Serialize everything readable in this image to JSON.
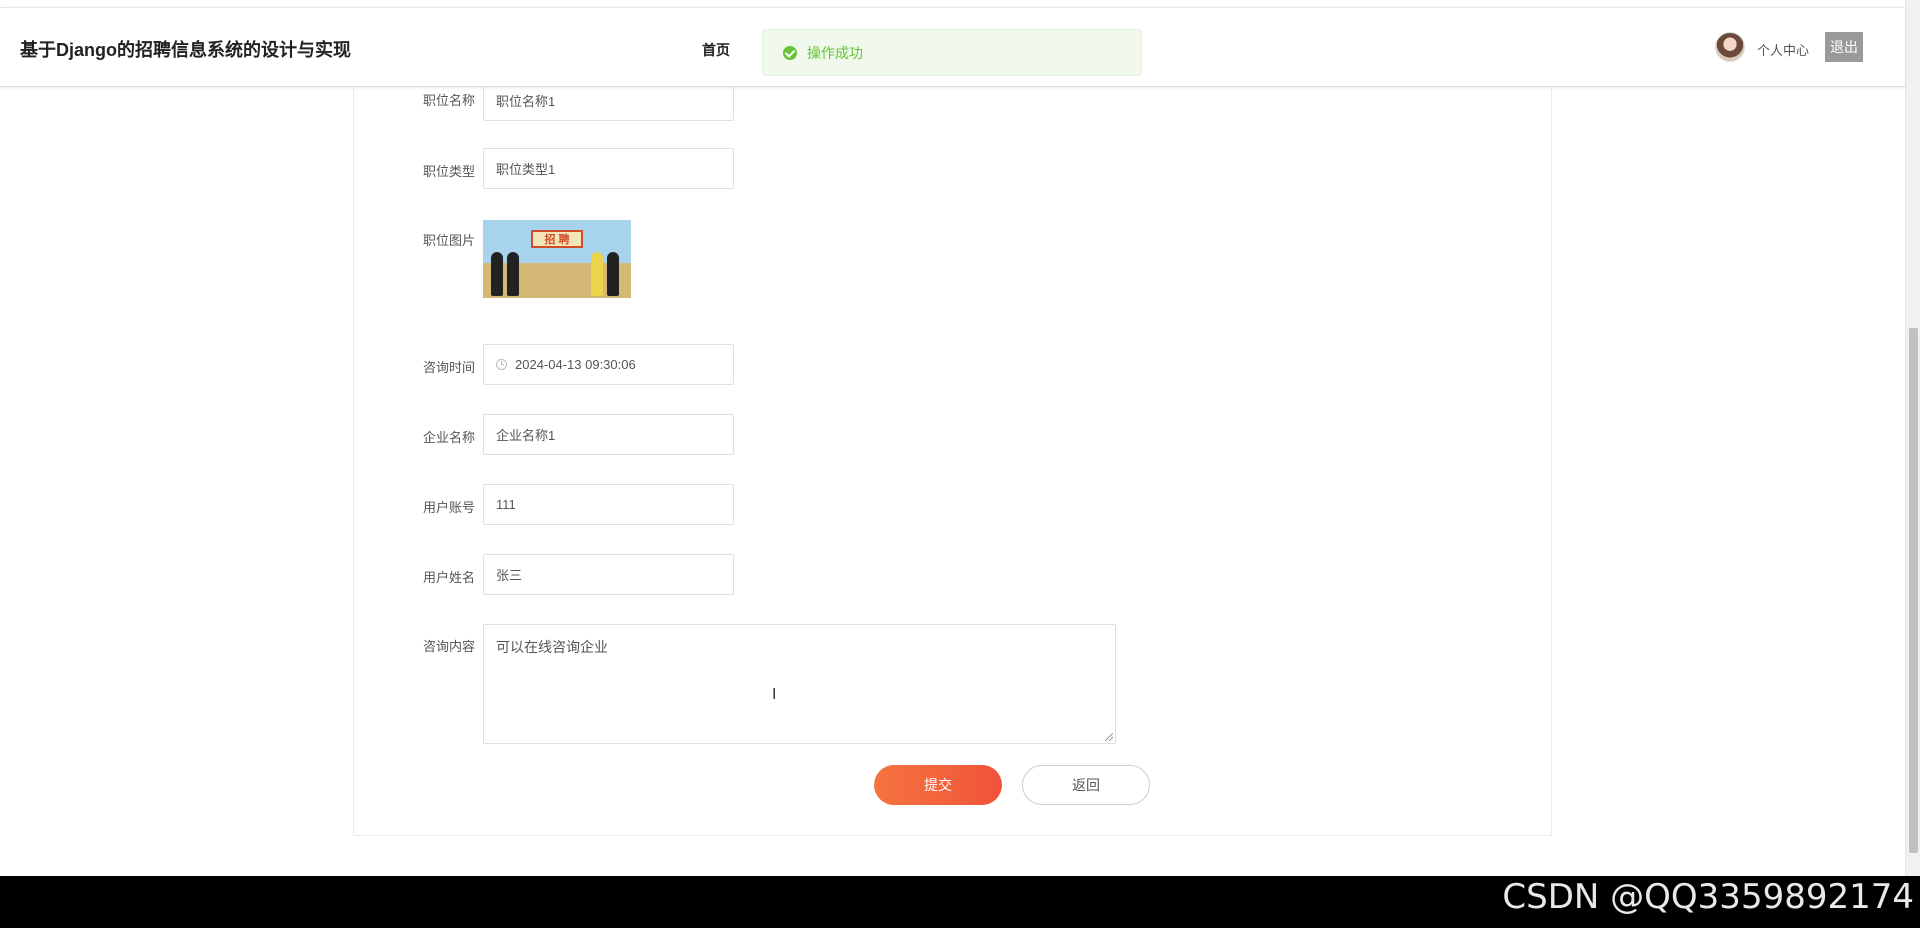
{
  "header": {
    "site_title": "基于Django的招聘信息系统的设计与实现",
    "nav_home": "首页",
    "toast_message": "操作成功",
    "user_center": "个人中心",
    "logout": "退出"
  },
  "form": {
    "job_name": {
      "label": "职位名称",
      "value": "职位名称1"
    },
    "job_type": {
      "label": "职位类型",
      "value": "职位类型1"
    },
    "job_image": {
      "label": "职位图片",
      "sign_text": "招 聘"
    },
    "consult_time": {
      "label": "咨询时间",
      "value": "2024-04-13 09:30:06"
    },
    "company_name": {
      "label": "企业名称",
      "value": "企业名称1"
    },
    "user_account": {
      "label": "用户账号",
      "value": "111"
    },
    "user_name": {
      "label": "用户姓名",
      "value": "张三"
    },
    "consult_content": {
      "label": "咨询内容",
      "value": "可以在线咨询企业"
    }
  },
  "actions": {
    "submit": "提交",
    "back": "返回"
  },
  "watermark": "CSDN @QQ3359892174",
  "colors": {
    "accent_start": "#f6743f",
    "accent_end": "#f0533a",
    "success": "#67c23a",
    "footer": "#000000"
  }
}
